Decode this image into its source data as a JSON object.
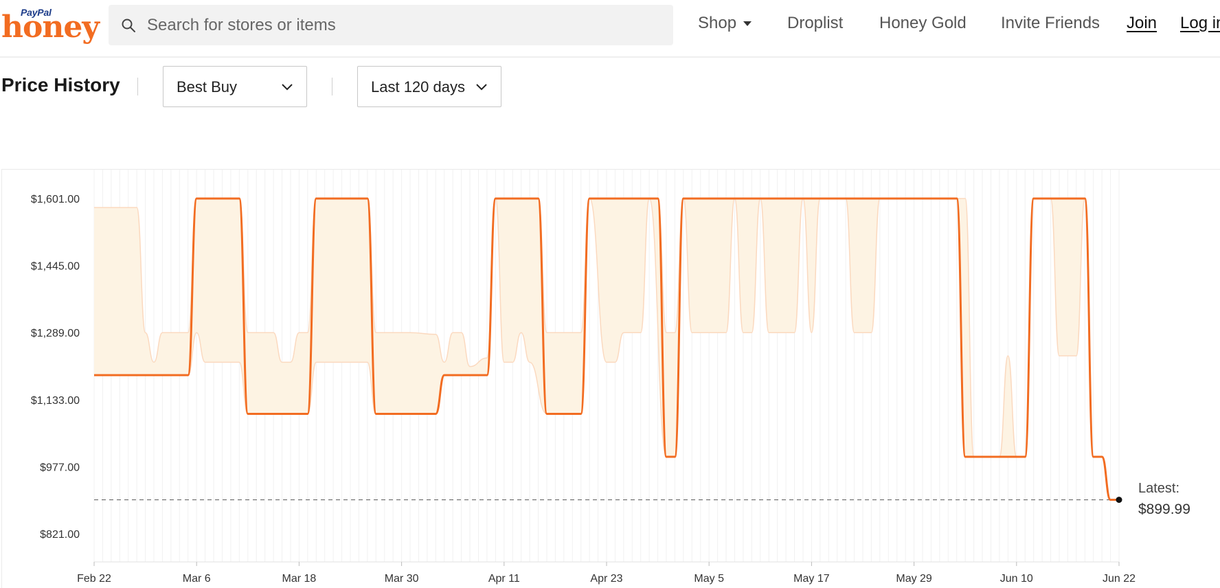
{
  "header": {
    "logo": {
      "brand_top": "PayPal",
      "brand": "honey"
    },
    "search": {
      "placeholder": "Search for stores or items"
    },
    "nav": [
      {
        "label": "Shop"
      },
      {
        "label": "Droplist"
      },
      {
        "label": "Honey Gold"
      },
      {
        "label": "Invite Friends"
      },
      {
        "label": "Join"
      },
      {
        "label": "Log in"
      }
    ]
  },
  "controls": {
    "title": "Price History",
    "store_select": "Best Buy",
    "range_select": "Last 120 days"
  },
  "latest": {
    "label": "Latest:",
    "value": "$899.99"
  },
  "colors": {
    "accent": "#f26c21",
    "range_fill": "#fdf3e3",
    "range_stroke": "#fbd9bf"
  },
  "chart_data": {
    "type": "line",
    "title": "",
    "xlabel": "",
    "ylabel": "",
    "ylim": [
      821,
      1601
    ],
    "y_ticks": [
      "$1,601.00",
      "$1,445.00",
      "$1,289.00",
      "$1,133.00",
      "$977.00",
      "$821.00"
    ],
    "y_tick_values": [
      1601,
      1445,
      1289,
      1133,
      977,
      821
    ],
    "xlim": [
      "Feb 22",
      "Jun 22"
    ],
    "x_ticks": [
      {
        "label": "Feb 22",
        "day": 0
      },
      {
        "label": "Mar 6",
        "day": 12
      },
      {
        "label": "Mar 18",
        "day": 24
      },
      {
        "label": "Mar 30",
        "day": 36
      },
      {
        "label": "Apr 11",
        "day": 48
      },
      {
        "label": "Apr 23",
        "day": 60
      },
      {
        "label": "May 5",
        "day": 72
      },
      {
        "label": "May 17",
        "day": 84
      },
      {
        "label": "May 29",
        "day": 96
      },
      {
        "label": "Jun 10",
        "day": 108
      },
      {
        "label": "Jun 22",
        "day": 120
      }
    ],
    "grid": "vertical-daily",
    "series": [
      {
        "role": "price",
        "points": [
          [
            0,
            1190
          ],
          [
            11,
            1190
          ],
          [
            12,
            1601
          ],
          [
            17,
            1601
          ],
          [
            18,
            1100
          ],
          [
            25,
            1100
          ],
          [
            26,
            1601
          ],
          [
            32,
            1601
          ],
          [
            33,
            1100
          ],
          [
            40,
            1100
          ],
          [
            41,
            1190
          ],
          [
            46,
            1190
          ],
          [
            47,
            1601
          ],
          [
            52,
            1601
          ],
          [
            53,
            1100
          ],
          [
            57,
            1100
          ],
          [
            58,
            1601
          ],
          [
            66,
            1601
          ],
          [
            67,
            1000
          ],
          [
            68,
            1000
          ],
          [
            69,
            1601
          ],
          [
            101,
            1601
          ],
          [
            102,
            1000
          ],
          [
            109,
            1000
          ],
          [
            110,
            1601
          ],
          [
            116,
            1601
          ],
          [
            117,
            1000
          ],
          [
            118,
            1000
          ],
          [
            119,
            899.99
          ],
          [
            120,
            899.99
          ]
        ]
      },
      {
        "role": "range_high",
        "points": [
          [
            0,
            1580
          ],
          [
            4,
            1580
          ],
          [
            5,
            1580
          ],
          [
            6,
            1289
          ],
          [
            7,
            1220
          ],
          [
            8,
            1289
          ],
          [
            11,
            1289
          ],
          [
            12,
            1601
          ],
          [
            17,
            1601
          ],
          [
            18,
            1289
          ],
          [
            21,
            1289
          ],
          [
            22,
            1220
          ],
          [
            23,
            1220
          ],
          [
            24,
            1289
          ],
          [
            25,
            1289
          ],
          [
            26,
            1601
          ],
          [
            32,
            1601
          ],
          [
            33,
            1289
          ],
          [
            34,
            1289
          ],
          [
            37,
            1289
          ],
          [
            40,
            1285
          ],
          [
            41,
            1220
          ],
          [
            42,
            1289
          ],
          [
            43,
            1289
          ],
          [
            44,
            1210
          ],
          [
            46,
            1230
          ],
          [
            47,
            1601
          ],
          [
            52,
            1601
          ],
          [
            53,
            1289
          ],
          [
            55,
            1289
          ],
          [
            57,
            1289
          ],
          [
            58,
            1601
          ],
          [
            66,
            1601
          ],
          [
            67,
            1289
          ],
          [
            68,
            1289
          ],
          [
            69,
            1601
          ],
          [
            101,
            1601
          ],
          [
            102,
            1601
          ],
          [
            103,
            1000
          ],
          [
            106,
            1000
          ],
          [
            107,
            1235
          ],
          [
            108,
            1000
          ],
          [
            109,
            1000
          ],
          [
            110,
            1601
          ],
          [
            116,
            1601
          ],
          [
            117,
            1000
          ],
          [
            118,
            1000
          ],
          [
            119,
            899.99
          ],
          [
            120,
            899.99
          ]
        ]
      },
      {
        "role": "range_low",
        "points": [
          [
            0,
            1190
          ],
          [
            11,
            1190
          ],
          [
            12,
            1289
          ],
          [
            13,
            1220
          ],
          [
            17,
            1220
          ],
          [
            18,
            1100
          ],
          [
            25,
            1100
          ],
          [
            26,
            1220
          ],
          [
            32,
            1220
          ],
          [
            33,
            1100
          ],
          [
            40,
            1100
          ],
          [
            41,
            1190
          ],
          [
            46,
            1190
          ],
          [
            47,
            1601
          ],
          [
            48,
            1220
          ],
          [
            49,
            1220
          ],
          [
            50,
            1289
          ],
          [
            51,
            1220
          ],
          [
            53,
            1100
          ],
          [
            57,
            1100
          ],
          [
            58,
            1601
          ],
          [
            60,
            1220
          ],
          [
            61,
            1220
          ],
          [
            62,
            1289
          ],
          [
            64,
            1289
          ],
          [
            65,
            1601
          ],
          [
            67,
            1000
          ],
          [
            68,
            1000
          ],
          [
            69,
            1601
          ],
          [
            70,
            1289
          ],
          [
            74,
            1289
          ],
          [
            75,
            1601
          ],
          [
            76,
            1289
          ],
          [
            77,
            1289
          ],
          [
            78,
            1601
          ],
          [
            79,
            1289
          ],
          [
            82,
            1289
          ],
          [
            83,
            1601
          ],
          [
            84,
            1289
          ],
          [
            85,
            1601
          ],
          [
            88,
            1601
          ],
          [
            89,
            1289
          ],
          [
            91,
            1289
          ],
          [
            92,
            1601
          ],
          [
            101,
            1601
          ],
          [
            102,
            1000
          ],
          [
            109,
            1000
          ],
          [
            110,
            1601
          ],
          [
            112,
            1601
          ],
          [
            113,
            1235
          ],
          [
            115,
            1235
          ],
          [
            116,
            1601
          ],
          [
            117,
            1000
          ],
          [
            118,
            1000
          ],
          [
            119,
            899.99
          ],
          [
            120,
            899.99
          ]
        ]
      }
    ],
    "latest_value": 899.99,
    "reference_line": 899.99
  }
}
